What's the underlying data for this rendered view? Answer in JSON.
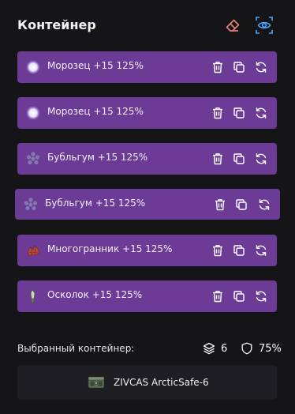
{
  "header": {
    "title": "Контейнер",
    "eraser_icon": "eraser-icon",
    "eye_icon": "eye-icon",
    "eraser_color": "#e8837a",
    "eye_color": "#3ea8ff"
  },
  "items": [
    {
      "label": "Морозец +15 125%",
      "icon": "frost-orb-icon"
    },
    {
      "label": "Морозец +15 125%",
      "icon": "frost-orb-icon"
    },
    {
      "label": "Бубльгум +15 125%",
      "icon": "bubblegum-icon"
    },
    {
      "label": "Бубльгум +15 125%",
      "icon": "bubblegum-icon"
    },
    {
      "label": "Многогранник +15 125%",
      "icon": "polyhedron-icon"
    },
    {
      "label": "Осколок +15 125%",
      "icon": "shard-icon"
    }
  ],
  "item_actions": [
    "trash-icon",
    "copy-icon",
    "swap-icon"
  ],
  "item_color": "#6b3b96",
  "selected": {
    "label": "Выбранный контейнер:",
    "count": "6",
    "protection": "75%",
    "container_name": "ZIVCAS ArcticSafe-6"
  }
}
